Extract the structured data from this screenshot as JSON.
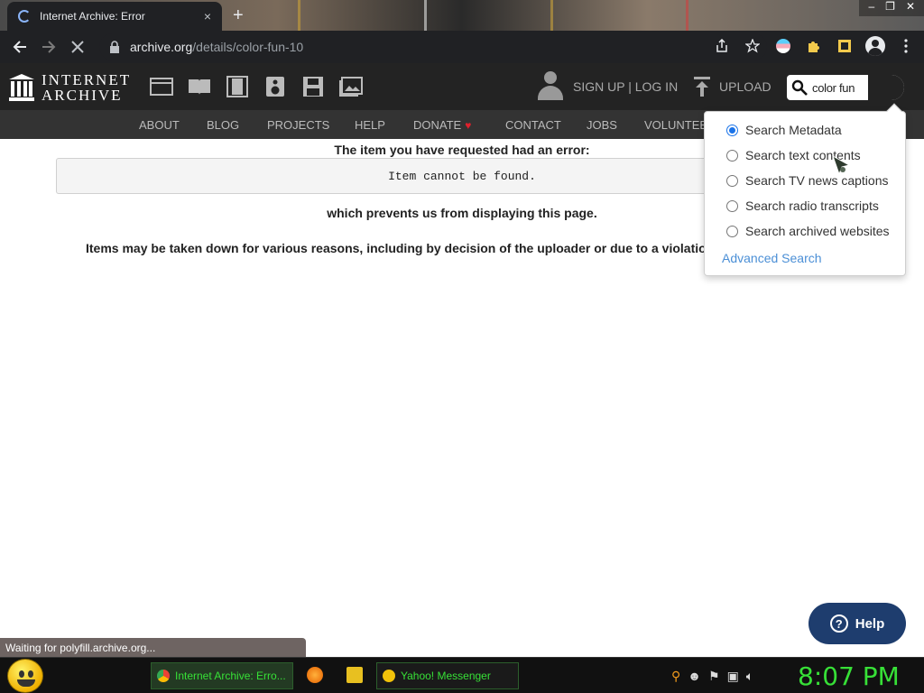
{
  "browser": {
    "tab_title": "Internet Archive: Error",
    "tab_close": "×",
    "new_tab": "+",
    "window_controls": [
      "–",
      "❐",
      "✕"
    ],
    "url_host": "archive.org",
    "url_path": "/details/color-fun-10"
  },
  "ia_header": {
    "logo_line1": "INTERNET",
    "logo_line2": "ARCHIVE",
    "media_icons": [
      "web-icon",
      "texts-icon",
      "video-icon",
      "audio-icon",
      "software-icon",
      "images-icon"
    ],
    "signup_login": "SIGN UP | LOG IN",
    "upload": "UPLOAD",
    "search_value": "color fun"
  },
  "ia_nav": {
    "items": [
      "ABOUT",
      "BLOG",
      "PROJECTS",
      "HELP",
      "DONATE",
      "CONTACT",
      "JOBS",
      "VOLUNTEE"
    ],
    "heart": "♥"
  },
  "content": {
    "error_title": "The item you have requested had an error:",
    "error_message": "Item cannot be found.",
    "prevents": "which prevents us from displaying this page.",
    "reason": "Items may be taken down for various reasons, including by decision of the uploader or due to a violatio"
  },
  "search_dropdown": {
    "options": [
      {
        "label": "Search Metadata",
        "selected": true
      },
      {
        "label": "Search text contents",
        "selected": false
      },
      {
        "label": "Search TV news captions",
        "selected": false
      },
      {
        "label": "Search radio transcripts",
        "selected": false
      },
      {
        "label": "Search archived websites",
        "selected": false
      }
    ],
    "advanced": "Advanced Search"
  },
  "help": {
    "label": "Help",
    "icon": "?"
  },
  "status_text": "Waiting for polyfill.archive.org...",
  "taskbar": {
    "chrome_task": "Internet Archive: Erro...",
    "yahoo_task": "Yahoo! Messenger",
    "clock": "8:07 PM"
  },
  "colors": {
    "ia_dark": "#232323",
    "ia_nav": "#333333",
    "link_blue": "#4b8fd6",
    "help_navy": "#1e3d6e",
    "taskbar_green": "#37e037"
  }
}
